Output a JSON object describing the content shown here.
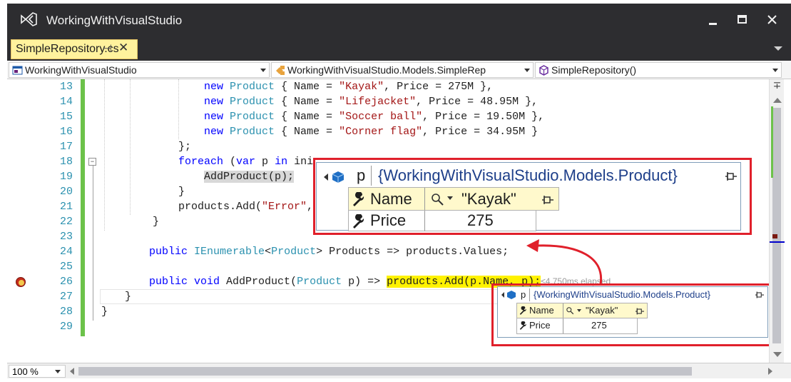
{
  "window": {
    "title": "WorkingWithVisualStudio"
  },
  "tab": {
    "label": "SimpleRepository.cs",
    "pin_glyph": "⊣",
    "close_glyph": "✕"
  },
  "navbar": {
    "project": "WorkingWithVisualStudio",
    "type": "WorkingWithVisualStudio.Models.SimpleRep",
    "member": "SimpleRepository()"
  },
  "lines": [
    {
      "n": "13"
    },
    {
      "n": "14"
    },
    {
      "n": "15"
    },
    {
      "n": "16"
    },
    {
      "n": "17"
    },
    {
      "n": "18"
    },
    {
      "n": "19"
    },
    {
      "n": "20"
    },
    {
      "n": "21"
    },
    {
      "n": "22"
    },
    {
      "n": "23"
    },
    {
      "n": "24"
    },
    {
      "n": "25"
    },
    {
      "n": "26"
    },
    {
      "n": "27"
    },
    {
      "n": "28"
    },
    {
      "n": "29"
    }
  ],
  "code": {
    "l13": {
      "kw": "new",
      "ty": "Product",
      "a": " { Name = ",
      "s": "\"Kayak\"",
      "b": ", Price = 275M },"
    },
    "l14": {
      "kw": "new",
      "ty": "Product",
      "a": " { Name = ",
      "s": "\"Lifejacket\"",
      "b": ", Price = 48.95M },"
    },
    "l15": {
      "kw": "new",
      "ty": "Product",
      "a": " { Name = ",
      "s": "\"Soccer ball\"",
      "b": ", Price = 19.50M },"
    },
    "l16": {
      "kw": "new",
      "ty": "Product",
      "a": " { Name = ",
      "s": "\"Corner flag\"",
      "b": ", Price = 34.95M }"
    },
    "l17": "};",
    "l18": {
      "kw1": "foreach",
      "a": " (",
      "kw2": "var",
      "b": " p ",
      "kw3": "in",
      "c": " ini"
    },
    "l19": "AddProduct(p);",
    "l20": "}",
    "l21": {
      "a": "products.Add(",
      "s": "\"Error\"",
      "b": ","
    },
    "l22": "}",
    "l24": {
      "kw": "public",
      "ty1": "IEnumerable",
      "lt": "<",
      "ty2": "Product",
      "rest": "> Products => products.Values;"
    },
    "l26": {
      "kw1": "public",
      "kw2": "void",
      "a": " AddProduct(",
      "ty": "Product",
      "b": " p) => ",
      "hl": "products.Add(p.Name, p);",
      "elapsed": "≤4,750ms elapsed"
    },
    "l27": "}",
    "l28": "}"
  },
  "datatip_large": {
    "header_var": "p",
    "header_type": "{WorkingWithVisualStudio.Models.Product}",
    "rows": [
      {
        "name": "Name",
        "value": "\"Kayak\""
      },
      {
        "name": "Price",
        "value": "275"
      }
    ]
  },
  "datatip_small": {
    "header_var": "p",
    "header_type": "{WorkingWithVisualStudio.Models.Product}",
    "rows": [
      {
        "name": "Name",
        "value": "\"Kayak\""
      },
      {
        "name": "Price",
        "value": "275"
      }
    ]
  },
  "status": {
    "zoom": "100 %"
  },
  "colors": {
    "titlebar": "#2d2d30",
    "tab_active": "#fff29d",
    "callout": "#e0202b",
    "keyword": "#0000ff",
    "type": "#2b91af",
    "string": "#a31515",
    "changebar": "#6cc24a"
  }
}
